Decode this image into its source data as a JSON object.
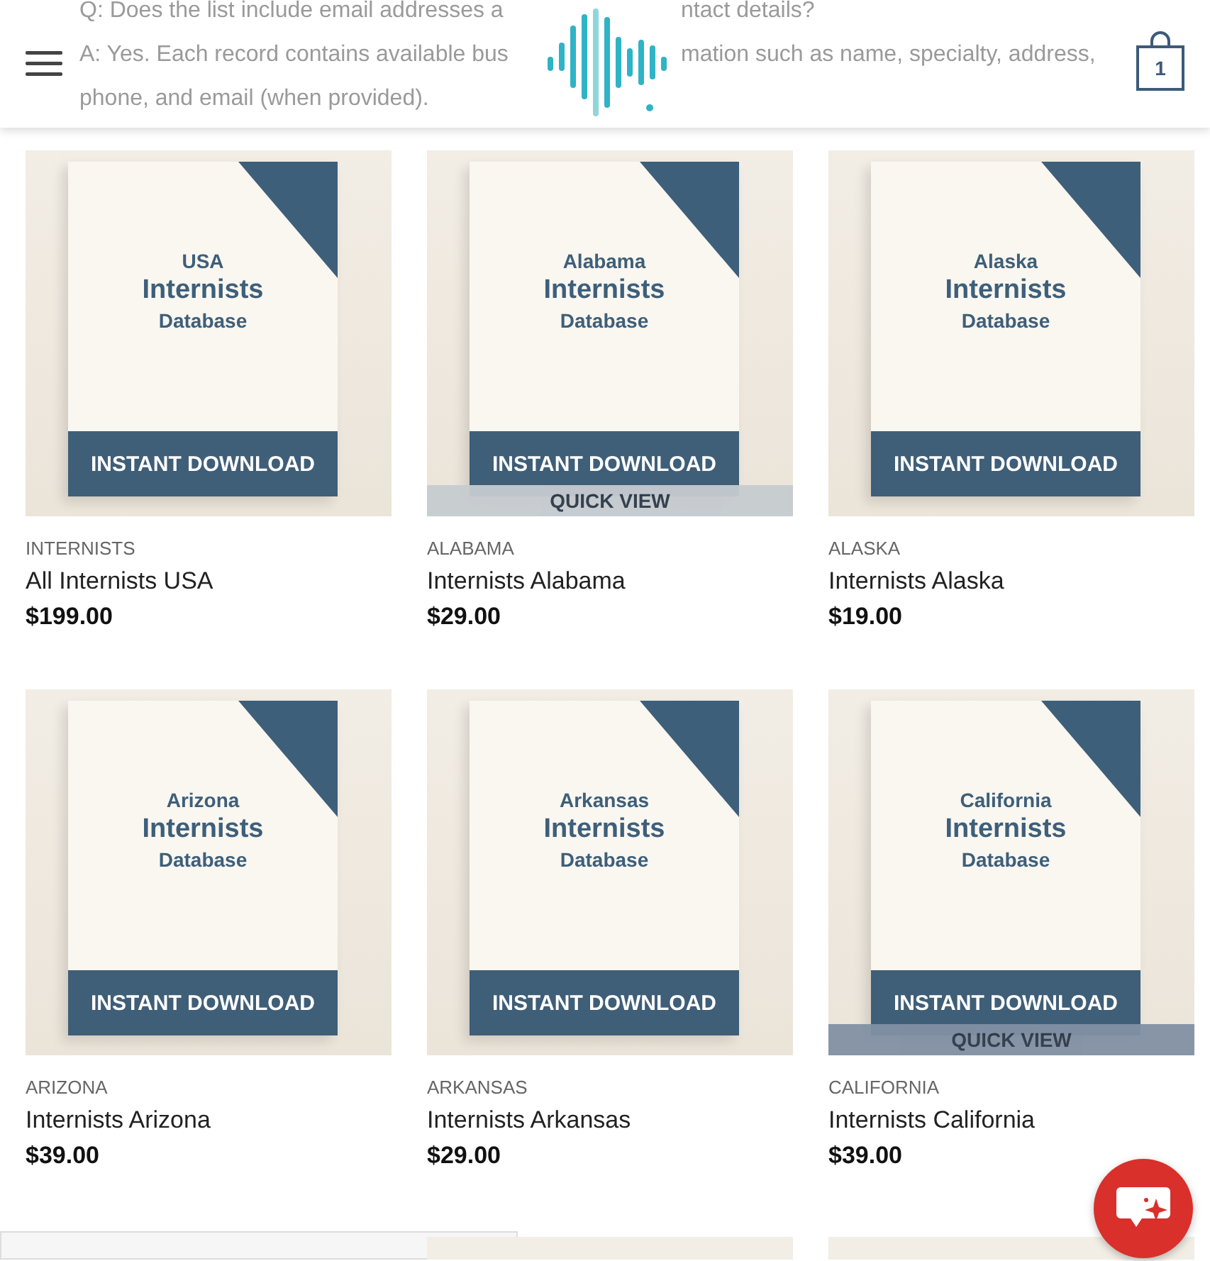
{
  "header": {
    "faq_lines": [
      {
        "left": "Q: Does the list include email addresses a",
        "right": "ntact details?"
      },
      {
        "left": "A: Yes. Each record contains available bus",
        "right": "mation such as name, specialty, address,"
      },
      {
        "left": "phone, and email (when provided)."
      }
    ],
    "cart_count": "1"
  },
  "products": [
    {
      "category": "INTERNISTS",
      "title": "All Internists USA",
      "price": "$199.00",
      "cover": {
        "region": "USA",
        "topic": "Internists",
        "subtitle": "Database",
        "banner": "INSTANT DOWNLOAD"
      }
    },
    {
      "category": "ALABAMA",
      "title": "Internists Alabama",
      "price": "$29.00",
      "cover": {
        "region": "Alabama",
        "topic": "Internists",
        "subtitle": "Database",
        "banner": "INSTANT DOWNLOAD"
      },
      "quick_view": {
        "label": "QUICK VIEW",
        "color": "#c6cbd0"
      }
    },
    {
      "category": "ALASKA",
      "title": "Internists Alaska",
      "price": "$19.00",
      "cover": {
        "region": "Alaska",
        "topic": "Internists",
        "subtitle": "Database",
        "banner": "INSTANT DOWNLOAD"
      }
    },
    {
      "category": "ARIZONA",
      "title": "Internists Arizona",
      "price": "$39.00",
      "cover": {
        "region": "Arizona",
        "topic": "Internists",
        "subtitle": "Database",
        "banner": "INSTANT DOWNLOAD"
      }
    },
    {
      "category": "ARKANSAS",
      "title": "Internists Arkansas",
      "price": "$29.00",
      "cover": {
        "region": "Arkansas",
        "topic": "Internists",
        "subtitle": "Database",
        "banner": "INSTANT DOWNLOAD"
      }
    },
    {
      "category": "CALIFORNIA",
      "title": "Internists California",
      "price": "$39.00",
      "cover": {
        "region": "California",
        "topic": "Internists",
        "subtitle": "Database",
        "banner": "INSTANT DOWNLOAD"
      },
      "quick_view": {
        "label": "QUICK VIEW",
        "color": "#8290a4"
      }
    }
  ]
}
